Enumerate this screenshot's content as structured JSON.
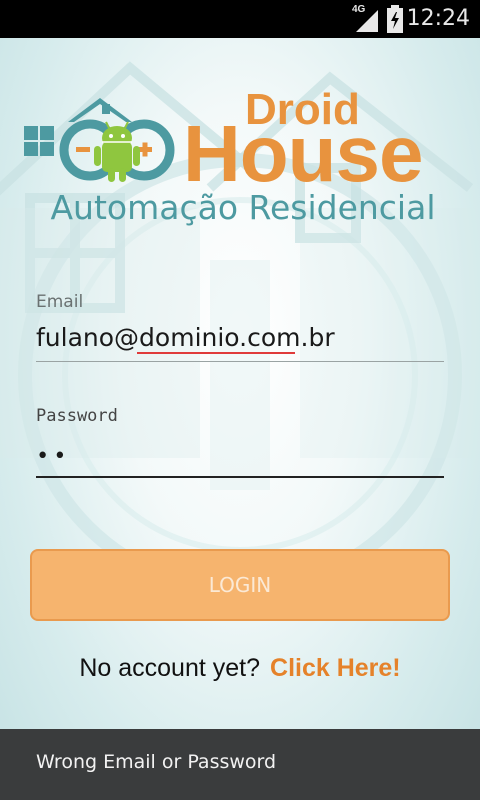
{
  "status_bar": {
    "network_type": "4G",
    "time": "12:24",
    "icons": [
      "signal-icon",
      "battery-charging-icon"
    ]
  },
  "logo": {
    "brand_top": "Droid",
    "brand_main": "House",
    "tagline": "Automação Residencial",
    "mascot_icon": "android-robot-icon",
    "colors": {
      "orange": "#e8933e",
      "teal": "#4d9aa1"
    }
  },
  "form": {
    "email": {
      "label": "Email",
      "value": "fulano@dominio.com.br"
    },
    "password": {
      "label": "Password",
      "value": "••"
    },
    "login_button": {
      "label": "LOGIN",
      "color": "#f6b46e"
    }
  },
  "signup": {
    "prompt": "No account yet?",
    "link": "Click Here!",
    "link_color": "#e5822a"
  },
  "toast": {
    "message": "Wrong Email or Password"
  }
}
